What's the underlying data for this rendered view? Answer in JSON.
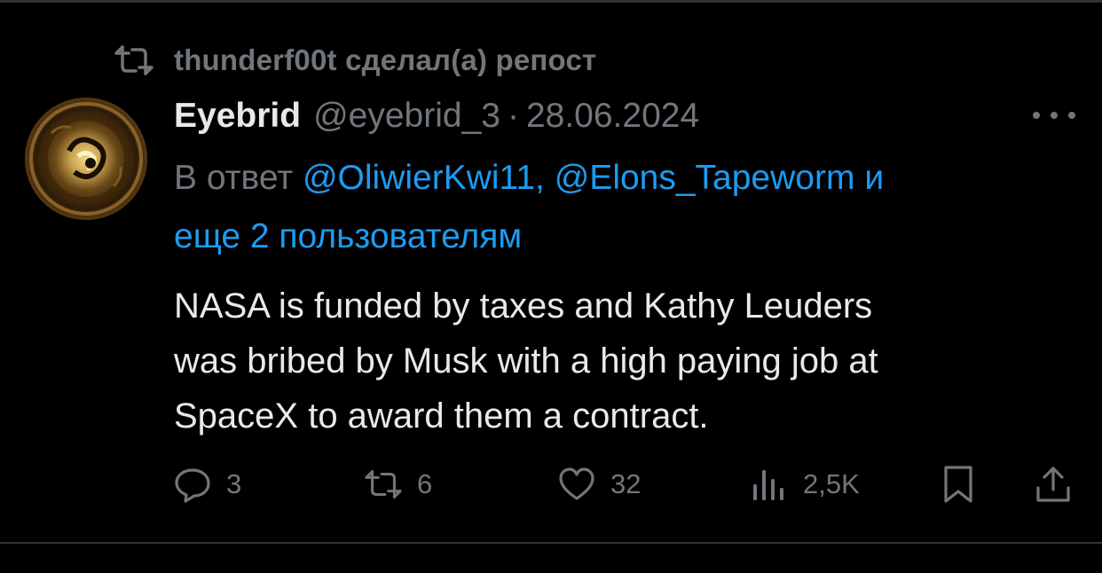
{
  "repost": {
    "icon": "repost-icon",
    "text": "thunderf00t сделал(а) репост"
  },
  "tweet": {
    "avatar_icon": "avatar-image",
    "author_name": "Eyebrid",
    "author_handle": "@eyebrid_3",
    "separator": "·",
    "date": "28.06.2024",
    "more_icon": "more-dots-icon",
    "reply": {
      "prefix": "В ответ",
      "mention_1": "@OliwierKwi11,",
      "mention_2": "@Elons_Tapeworm",
      "and": "и",
      "more": "еще 2 пользователям"
    },
    "text_lines": [
      "NASA is funded by taxes and Kathy Leuders",
      "was bribed by Musk with a high paying job at",
      "SpaceX to award them a contract."
    ]
  },
  "actions": {
    "replies": {
      "icon": "reply-icon",
      "count": "3"
    },
    "reposts": {
      "icon": "repost-icon",
      "count": "6"
    },
    "likes": {
      "icon": "heart-icon",
      "count": "32"
    },
    "views": {
      "icon": "views-icon",
      "count": "2,5K"
    },
    "bookmark": {
      "icon": "bookmark-icon"
    },
    "share": {
      "icon": "share-icon"
    }
  },
  "colors": {
    "background": "#000000",
    "text_primary": "#e7e9ea",
    "text_secondary": "#71767b",
    "link": "#1d9bf0",
    "divider": "#2f3336"
  }
}
